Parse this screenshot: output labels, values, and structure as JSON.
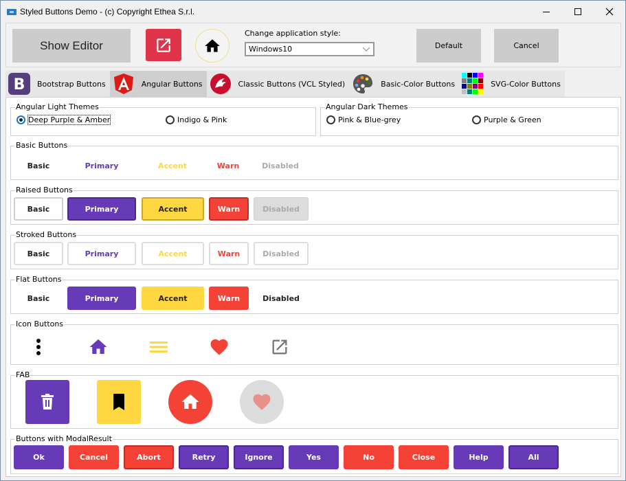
{
  "window": {
    "title": "Styled Buttons Demo - (c) Copyright Ethea S.r.l.",
    "controls": [
      "minimize",
      "maximize",
      "close"
    ]
  },
  "toolbar": {
    "show_editor_label": "Show Editor",
    "style_label": "Change application style:",
    "style_value": "Windows10",
    "default_label": "Default",
    "cancel_label": "Cancel",
    "colors": {
      "external_link_bg": "#e0344a",
      "home_circle_border": "#f5dc8a"
    }
  },
  "tabs": [
    {
      "label": "Bootstrap Buttons",
      "icon": "bootstrap-icon",
      "active": false
    },
    {
      "label": "Angular Buttons",
      "icon": "angular-icon",
      "active": true
    },
    {
      "label": "Classic Buttons (VCL Styled)",
      "icon": "delphi-icon",
      "active": false
    },
    {
      "label": "Basic-Color Buttons",
      "icon": "palette-icon",
      "active": false
    },
    {
      "label": "SVG-Color Buttons",
      "icon": "color-grid-icon",
      "active": false
    }
  ],
  "themes": {
    "light_title": "Angular Light Themes",
    "light": [
      {
        "label": "Deep Purple & Amber",
        "checked": true
      },
      {
        "label": "Indigo & Pink",
        "checked": false
      }
    ],
    "dark_title": "Angular Dark Themes",
    "dark": [
      {
        "label": "Pink & Blue-grey",
        "checked": false
      },
      {
        "label": "Purple & Green",
        "checked": false
      }
    ]
  },
  "colors": {
    "primary": "#673ab7",
    "accent": "#ffd740",
    "warn": "#f44336",
    "disabled_bg": "#dcdcdc",
    "disabled_text": "#aaaaaa"
  },
  "groups": {
    "basic": {
      "title": "Basic Buttons",
      "buttons": [
        "Basic",
        "Primary",
        "Accent",
        "Warn",
        "Disabled"
      ]
    },
    "raised": {
      "title": "Raised Buttons",
      "buttons": [
        "Basic",
        "Primary",
        "Accent",
        "Warn",
        "Disabled"
      ]
    },
    "stroked": {
      "title": "Stroked Buttons",
      "buttons": [
        "Basic",
        "Primary",
        "Accent",
        "Warn",
        "Disabled"
      ]
    },
    "flat": {
      "title": "Flat Buttons",
      "buttons": [
        "Basic",
        "Primary",
        "Accent",
        "Warn",
        "Disabled"
      ]
    },
    "icon": {
      "title": "Icon Buttons",
      "icons": [
        "more-vert-icon",
        "home-icon",
        "menu-icon",
        "heart-icon",
        "open-in-new-icon"
      ]
    },
    "fab": {
      "title": "FAB",
      "icons": [
        "trash-icon",
        "bookmark-icon",
        "home-icon",
        "heart-icon"
      ]
    },
    "modal": {
      "title": "Buttons with ModalResult",
      "buttons": [
        "Ok",
        "Cancel",
        "Abort",
        "Retry",
        "Ignore",
        "Yes",
        "No",
        "Close",
        "Help",
        "All"
      ]
    }
  }
}
